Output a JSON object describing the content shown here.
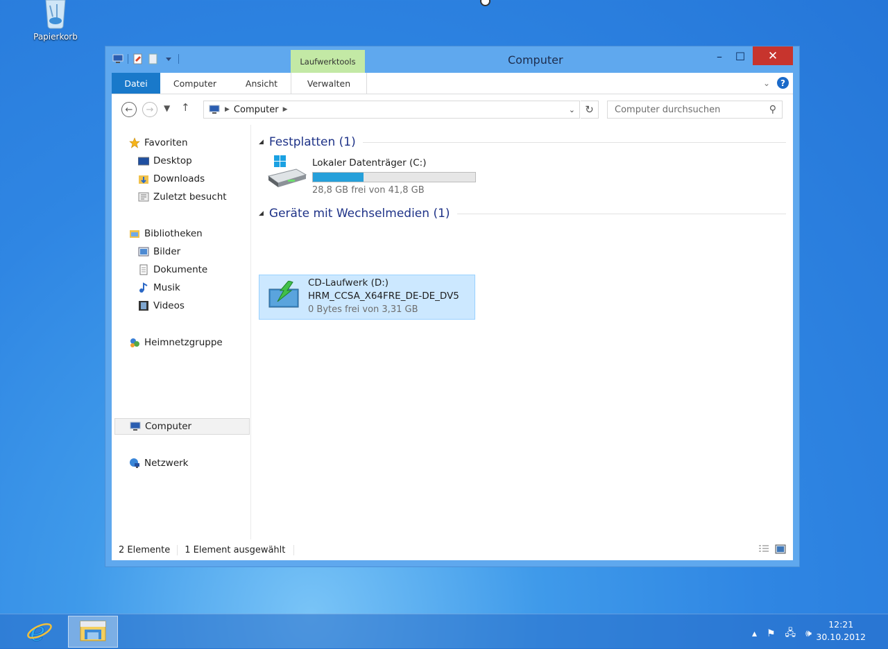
{
  "desktop": {
    "recycle_bin_label": "Papierkorb"
  },
  "window": {
    "title": "Computer",
    "contextual_tab_group": "Laufwerktools",
    "controls": {
      "minimize": "–",
      "maximize": "☐",
      "close": "✕"
    }
  },
  "ribbon": {
    "tabs": [
      "Datei",
      "Computer",
      "Ansicht",
      "Verwalten"
    ],
    "help": "?",
    "expand": "⌄"
  },
  "address": {
    "path": [
      "Computer"
    ],
    "search_placeholder": "Computer durchsuchen"
  },
  "sidebar": {
    "favorites": {
      "label": "Favoriten",
      "items": [
        "Desktop",
        "Downloads",
        "Zuletzt besucht"
      ]
    },
    "libraries": {
      "label": "Bibliotheken",
      "items": [
        "Bilder",
        "Dokumente",
        "Musik",
        "Videos"
      ]
    },
    "homegroup": "Heimnetzgruppe",
    "computer": "Computer",
    "network": "Netzwerk"
  },
  "content": {
    "groups": [
      {
        "title": "Festplatten (1)",
        "drives": [
          {
            "name": "Lokaler Datenträger (C:)",
            "detail": "28,8 GB frei von 41,8 GB",
            "used_fraction": 0.31
          }
        ]
      },
      {
        "title": "Geräte mit Wechselmedien (1)",
        "drives": [
          {
            "name": "CD-Laufwerk (D:)",
            "volume": "HRM_CCSA_X64FRE_DE-DE_DV5",
            "detail": "0 Bytes frei von 3,31 GB"
          }
        ]
      }
    ]
  },
  "status": {
    "count": "2 Elemente",
    "selection": "1 Element ausgewählt"
  },
  "taskbar": {
    "time": "12:21",
    "date": "30.10.2012"
  },
  "colors": {
    "accent": "#1979ca",
    "close_button": "#c7342d",
    "context_tab": "#c3e9a5",
    "progress_fill": "#26a0da",
    "selection_bg": "#cce8ff"
  }
}
